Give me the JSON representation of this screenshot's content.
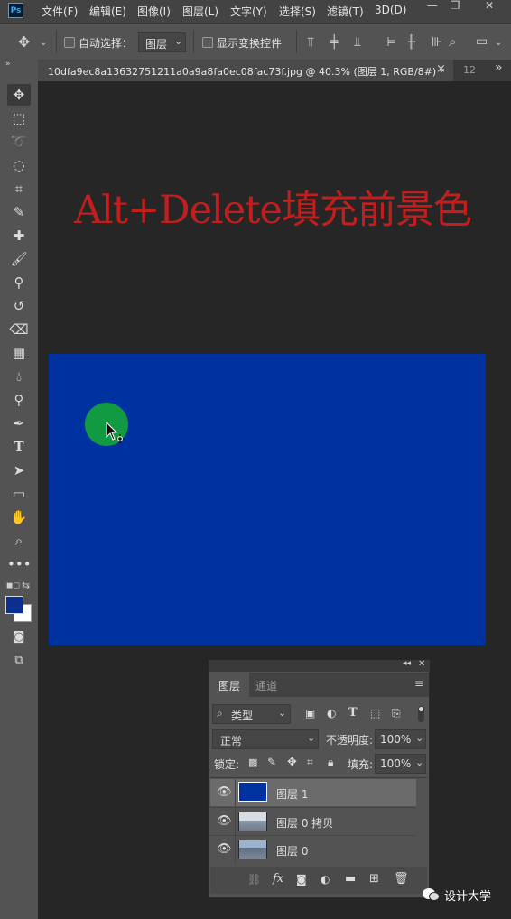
{
  "app": {
    "logo": "Ps"
  },
  "menubar": {
    "items": [
      "文件(F)",
      "编辑(E)",
      "图像(I)",
      "图层(L)",
      "文字(Y)",
      "选择(S)",
      "滤镜(T)",
      "3D(D)"
    ],
    "window_controls": [
      "minimize",
      "restore",
      "close"
    ]
  },
  "options": {
    "auto_select_label": "自动选择：",
    "auto_select_value": "图层",
    "show_transform_label": "显示变换控件"
  },
  "document_tab": {
    "title": "10dfa9ec8a13632751211a0a9a8fa0ec08fac73f.jpg @ 40.3% (图层 1, RGB/8#) *",
    "close": "×",
    "next_tab": "12",
    "overflow": "»"
  },
  "toolbar": {
    "tools": [
      "move-tool-icon",
      "marquee-tool-icon",
      "lasso-tool-icon",
      "quick-select-tool-icon",
      "crop-tool-icon",
      "eyedropper-tool-icon",
      "healing-tool-icon",
      "brush-tool-icon",
      "stamp-tool-icon",
      "history-brush-tool-icon",
      "eraser-tool-icon",
      "gradient-tool-icon",
      "blur-tool-icon",
      "dodge-tool-icon",
      "pen-tool-icon",
      "type-tool-icon",
      "path-select-tool-icon",
      "rectangle-tool-icon",
      "hand-tool-icon",
      "zoom-tool-icon",
      "more-tools-icon"
    ],
    "foreground_color": "#0a2f8f",
    "background_color": "#ffffff"
  },
  "canvas": {
    "headline": "Alt+Delete填充前景色",
    "headline_color": "#c11e1e",
    "fill_color": "#0031a0",
    "dot_color": "#129a43"
  },
  "layers_panel": {
    "tabs": [
      "图层",
      "通道"
    ],
    "filter_label": "类型",
    "blend_mode": "正常",
    "opacity_label": "不透明度:",
    "opacity_value": "100%",
    "lock_label": "锁定:",
    "fill_label": "填充:",
    "fill_value": "100%",
    "layers": [
      {
        "name": "图层 1",
        "selected": true,
        "thumb_color": "#0031a0"
      },
      {
        "name": "图层 0 拷贝",
        "selected": false,
        "thumb_color": "#8a98a8"
      },
      {
        "name": "图层 0",
        "selected": false,
        "thumb_color": "#6d86a3"
      }
    ]
  },
  "watermark": {
    "text": "设计大学"
  }
}
